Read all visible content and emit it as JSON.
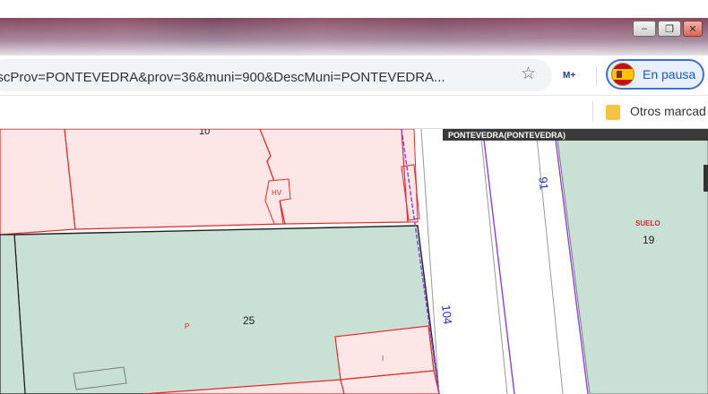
{
  "browser": {
    "address_text": "escProv=PONTEVEDRA&prov=36&muni=900&DescMuni=PONTEVEDRA...",
    "profile_label": "En pausa",
    "extension_icon": "M+",
    "bookmark_folder_label": "Otros marcad",
    "icons": {
      "bookmark": "star-icon",
      "profile": "spain-flag-avatar-icon",
      "folder": "folder-icon"
    }
  },
  "window": {
    "minimize_label": "–",
    "maximize_label": "❐",
    "close_label": "✕"
  },
  "map": {
    "header_label": "PONTEVEDRA(PONTEVEDRA)",
    "parcel_numbers": {
      "top_left": "10",
      "center": "25",
      "right": "19"
    },
    "suelo_label": "SUELO",
    "street_numbers": {
      "upper": "91",
      "lower": "104"
    },
    "small_labels": {
      "hv": "HV",
      "p": "P",
      "i": "I"
    },
    "colors": {
      "pink_parcel": "#fde6e6",
      "green_parcel": "#c9e0d5",
      "parcel_border_red": "#e02a2a",
      "boundary_purple": "#8a3ee6"
    }
  }
}
